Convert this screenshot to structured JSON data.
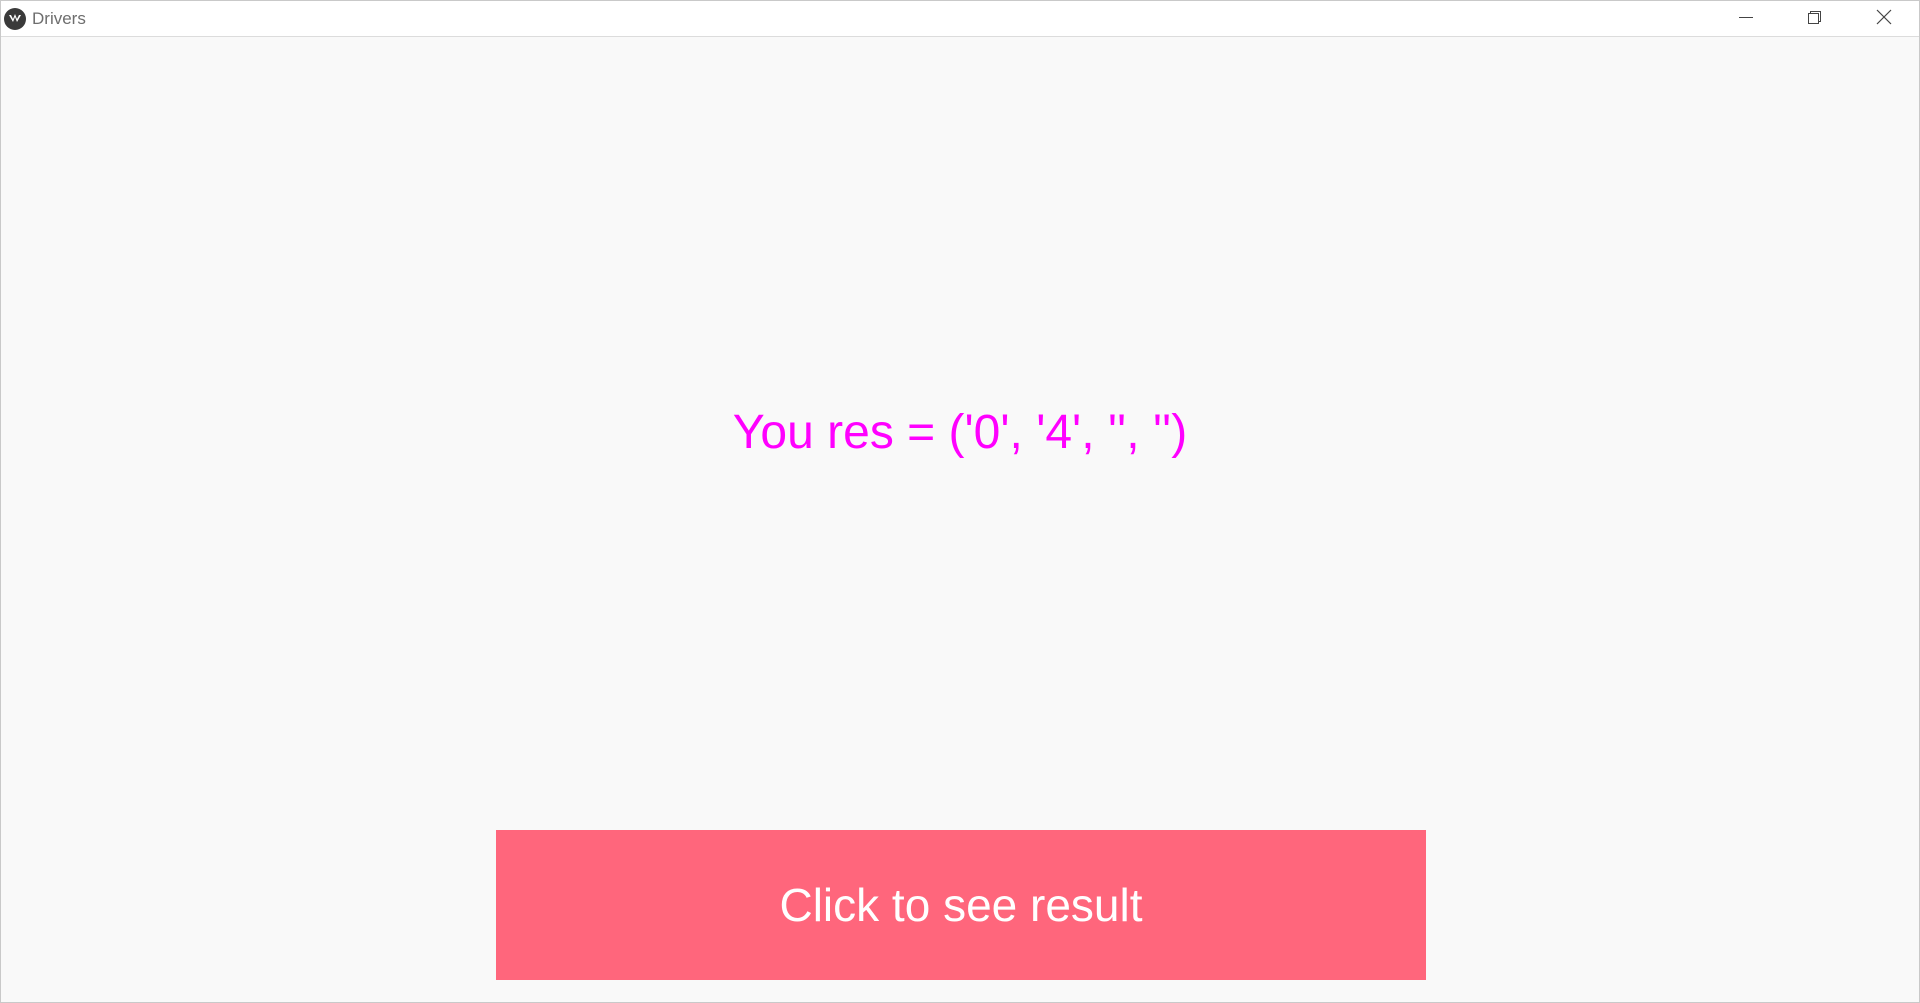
{
  "window": {
    "title": "Drivers",
    "app_icon": "kivy-logo-icon",
    "controls": {
      "minimize_icon": "minimize-icon",
      "restore_icon": "restore-icon",
      "close_icon": "close-icon"
    }
  },
  "main": {
    "result_label": "You res = ('0', '4', '', '')",
    "button_label": "Click to see result"
  },
  "colors": {
    "background": "#f9f9f9",
    "result_text": "#ff00ff",
    "button_background": "#ff667c",
    "button_text": "#ffffff"
  }
}
